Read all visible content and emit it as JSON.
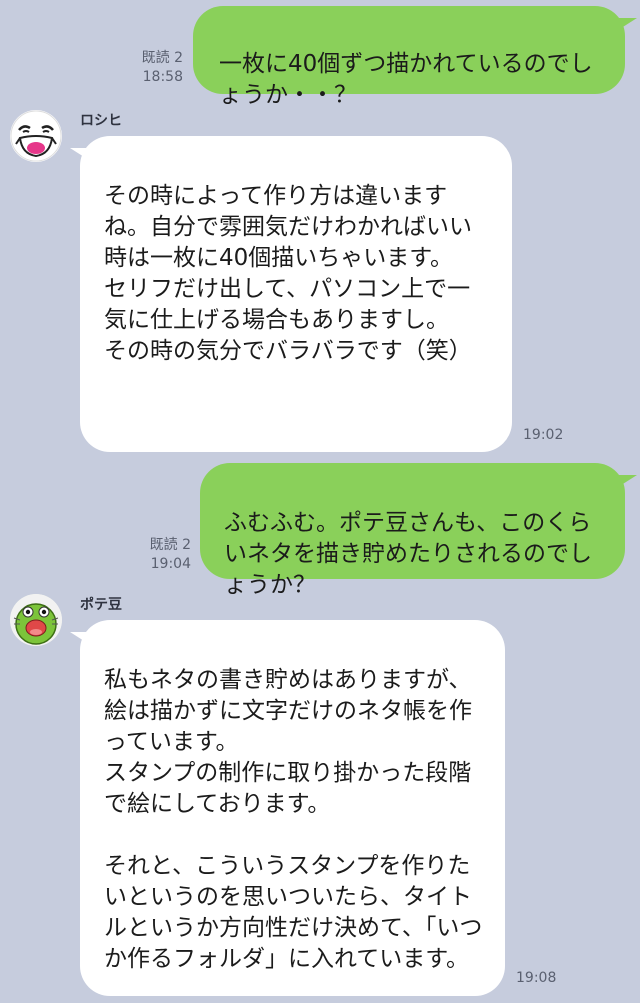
{
  "messages": [
    {
      "sender": "me",
      "read_label": "既読 2",
      "time": "18:58",
      "text": "一枚に40個ずつ描かれているのでしょうか・・？"
    },
    {
      "sender": "ロシヒ",
      "time": "19:02",
      "text": "その時によって作り方は違いますね。自分で雰囲気だけわかればいい時は一枚に40個描いちゃいます。\nセリフだけ出して、パソコン上で一気に仕上げる場合もありますし。\nその時の気分でバラバラです（笑）"
    },
    {
      "sender": "me",
      "read_label": "既読 2",
      "time": "19:04",
      "text": "ふむふむ。ポテ豆さんも、このくらいネタを描き貯めたりされるのでしょうか？"
    },
    {
      "sender": "ポテ豆",
      "time": "19:08",
      "text": "私もネタの書き貯めはありますが、絵は描かずに文字だけのネタ帳を作っています。\nスタンプの制作に取り掛かった段階で絵にしております。\n\nそれと、こういうスタンプを作りたいというのを思いついたら、タイトルというか方向性だけ決めて、「いつか作るフォルダ」に入れています。"
    }
  ],
  "avatars": {
    "roshihi": "face-avatar-icon",
    "potemame": "green-bean-avatar-icon"
  },
  "colors": {
    "background": "#c6ccdd",
    "my_bubble": "#8ad05a",
    "their_bubble": "#ffffff",
    "potemame_green": "#7cc43a"
  }
}
